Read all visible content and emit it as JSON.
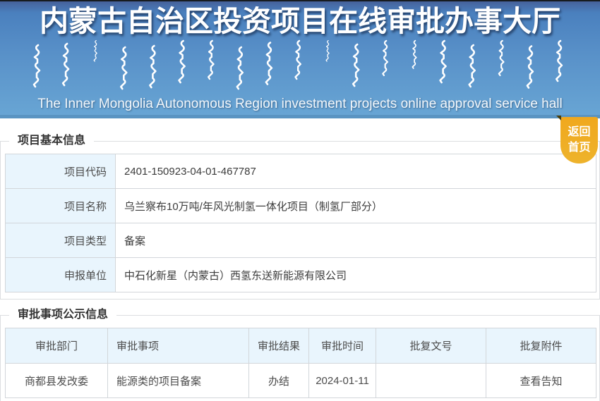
{
  "header": {
    "title_cn": "内蒙古自治区投资项目在线审批办事大厅",
    "subtitle_en": "The Inner Mongolia Autonomous Region investment projects online approval service hall"
  },
  "back_button": {
    "line1": "返回",
    "line2": "首页"
  },
  "project_info": {
    "section_title": "项目基本信息",
    "rows": [
      {
        "label": "项目代码",
        "value": "2401-150923-04-01-467787"
      },
      {
        "label": "项目名称",
        "value": "乌兰察布10万吨/年风光制氢一体化项目（制氢厂部分）"
      },
      {
        "label": "项目类型",
        "value": "备案"
      },
      {
        "label": "申报单位",
        "value": "中石化新星（内蒙古）西氢东送新能源有限公司"
      }
    ]
  },
  "approval_info": {
    "section_title": "审批事项公示信息",
    "columns": [
      "审批部门",
      "审批事项",
      "审批结果",
      "审批时间",
      "批复文号",
      "批复附件"
    ],
    "rows": [
      {
        "department": "商都县发改委",
        "item": "能源类的项目备案",
        "result": "办结",
        "time": "2024-01-11",
        "doc_no": "",
        "attachment": "查看告知"
      }
    ]
  },
  "colors": {
    "banner_blue_top": "#4a80be",
    "banner_blue_bottom": "#68a5d4",
    "banner_bottom_strip": "#5a94c2",
    "accent_orange": "#efac28",
    "cell_light_blue": "#e9f5fd",
    "table_border": "#d2d6da",
    "title_text": "#333333"
  }
}
